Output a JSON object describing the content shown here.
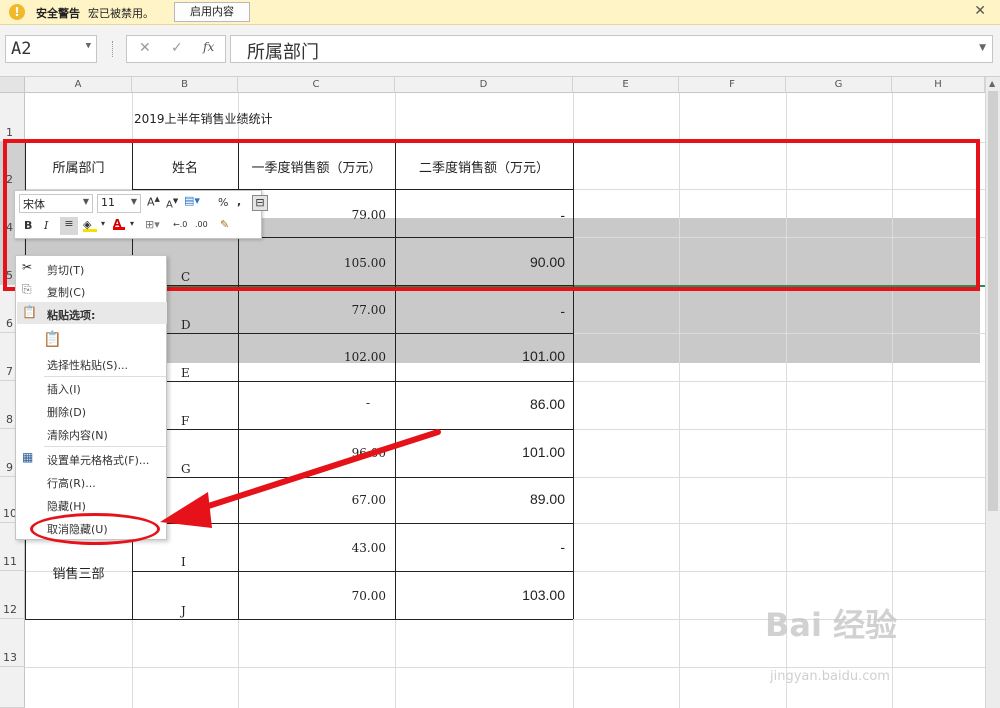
{
  "security_bar": {
    "title": "安全警告",
    "message": "宏已被禁用。",
    "enable_button": "启用内容"
  },
  "formula_bar": {
    "name_box": "A2",
    "fx_label": "fx",
    "content": "所属部门"
  },
  "columns": [
    "A",
    "B",
    "C",
    "D",
    "E",
    "F",
    "G",
    "H"
  ],
  "rows": [
    "1",
    "2",
    "4",
    "5",
    "6",
    "7",
    "8",
    "9",
    "10",
    "11",
    "12",
    "13"
  ],
  "sheet": {
    "title": "2019上半年销售业绩统计",
    "headers": [
      "所属部门",
      "姓名",
      "一季度销售额（万元）",
      "二季度销售额（万元）"
    ],
    "dept_visible": "销售三部",
    "data_rows": [
      {
        "row": "4",
        "name": "",
        "q1": "79.00",
        "q2": "-"
      },
      {
        "row": "5",
        "name": "C",
        "q1": "105.00",
        "q2": "90.00"
      },
      {
        "row": "6",
        "name": "D",
        "q1": "77.00",
        "q2": "-"
      },
      {
        "row": "7",
        "name": "E",
        "q1": "102.00",
        "q2": "101.00"
      },
      {
        "row": "8",
        "name": "F",
        "q1": "-",
        "q2": "86.00"
      },
      {
        "row": "9",
        "name": "G",
        "q1": "96.00",
        "q2": "101.00"
      },
      {
        "row": "10",
        "name": "",
        "q1": "67.00",
        "q2": "89.00"
      },
      {
        "row": "11",
        "name": "I",
        "q1": "43.00",
        "q2": "-"
      },
      {
        "row": "12",
        "name": "J",
        "q1": "70.00",
        "q2": "103.00"
      }
    ]
  },
  "mini_toolbar": {
    "font_name": "宋体",
    "font_size": "11",
    "bold": "B",
    "italic": "I",
    "percent": "%",
    "comma": ","
  },
  "context_menu": {
    "cut": "剪切(T)",
    "copy": "复制(C)",
    "paste_options": "粘贴选项:",
    "paste_special": "选择性粘贴(S)...",
    "insert": "插入(I)",
    "delete": "删除(D)",
    "clear": "清除内容(N)",
    "format_cells": "设置单元格格式(F)...",
    "row_height": "行高(R)...",
    "hide": "隐藏(H)",
    "unhide": "取消隐藏(U)"
  },
  "watermark": {
    "brand": "Bai 经验",
    "url": "jingyan.baidu.com"
  }
}
